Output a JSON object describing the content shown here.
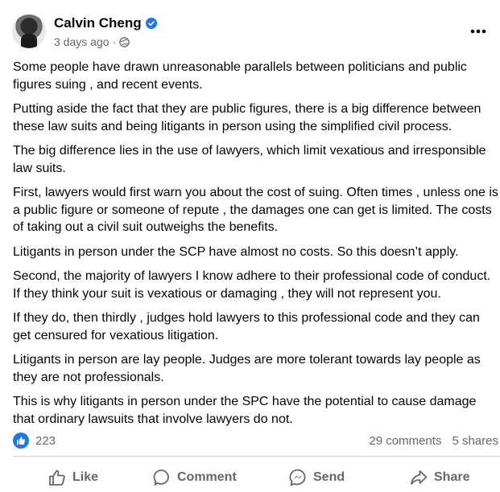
{
  "post": {
    "author": "Calvin Cheng",
    "timestamp": "3 days ago",
    "separator": "·",
    "audience_icon": "globe-icon",
    "verified_icon": "verified-badge-icon",
    "paragraphs": [
      "Some people have drawn unreasonable parallels between politicians and public figures suing , and recent events.",
      "Putting aside the fact that they are public figures, there is a big difference between these law suits and being litigants in person using the simplified civil process.",
      "The big difference lies in the use of lawyers, which limit vexatious and irresponsible law suits.",
      "First, lawyers would first warn you about the cost of suing. Often times , unless one is a public figure or someone of repute , the damages one can get is limited. The costs of taking out a civil suit outweighs the benefits.",
      "Litigants in person under the SCP have almost no costs. So this doesn’t apply.",
      "Second, the majority of lawyers I know adhere to their professional code of conduct. If they think your suit is vexatious or damaging , they will not represent you.",
      "If they do, then thirdly , judges hold lawyers to this professional code and they can get censured for vexatious litigation.",
      "Litigants in person are lay people. Judges are more tolerant towards lay people as they are not professionals.",
      "This is why litigants in person under the SPC have the potential to cause damage that ordinary lawsuits that involve lawyers do not."
    ],
    "reaction_count": "223",
    "comments": "29 comments",
    "shares": "5 shares",
    "actions": {
      "like": "Like",
      "comment": "Comment",
      "send": "Send",
      "share": "Share"
    }
  },
  "colors": {
    "accent": "#1877f2",
    "secondary_text": "#65676b",
    "divider": "#ced0d4"
  }
}
